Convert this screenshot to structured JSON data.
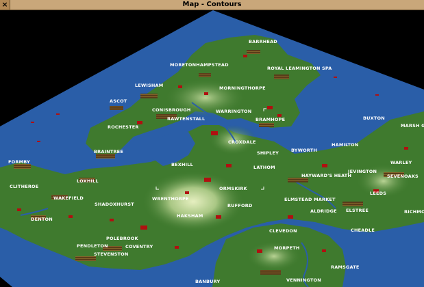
{
  "window": {
    "title": "Map - Contours",
    "close_icon": "close-x-icon"
  },
  "map": {
    "view": "contours",
    "colors": {
      "water": "#2a5ea8",
      "lowland": "#3f7a2e",
      "highland": "#a9c784",
      "peak": "#e6efc0",
      "town": "#b01010"
    },
    "towns": [
      "BARRHEAD",
      "MORETONHAMPSTEAD",
      "ROYAL LEAMINGTON SPA",
      "LEWISHAM",
      "MORNINGTHORPE",
      "ASCOT",
      "CONISBROUGH",
      "WARRINGTON",
      "RAWTENSTALL",
      "BRAMHOPE",
      "ROCHESTER",
      "BUXTON",
      "MARSH GRE",
      "CROXDALE",
      "BRAINTREE",
      "SHIPLEY",
      "BYWORTH",
      "HAMILTON",
      "FORMBY",
      "BEXHILL",
      "LATHOM",
      "WARLEY",
      "JEVINGTON",
      "HAYWARD'S HEATH",
      "SEVENOAKS",
      "CLITHEROE",
      "LOXHILL",
      "ORMSKIRK",
      "LEEDS",
      "WAKEFIELD",
      "WRENTHORPE",
      "ELMSTEAD MARKET",
      "SHADOXHURST",
      "RUFFORD",
      "ALDRIDGE",
      "ELSTREE",
      "RICHMON",
      "DENTON",
      "HAKSHAM",
      "CHEADLE",
      "CLEVEDON",
      "POLEBROOK",
      "PENDLETON",
      "COVENTRY",
      "STEVENSTON",
      "MORPETH",
      "RAMSGATE",
      "BANBURY",
      "VENNINGTON"
    ]
  }
}
